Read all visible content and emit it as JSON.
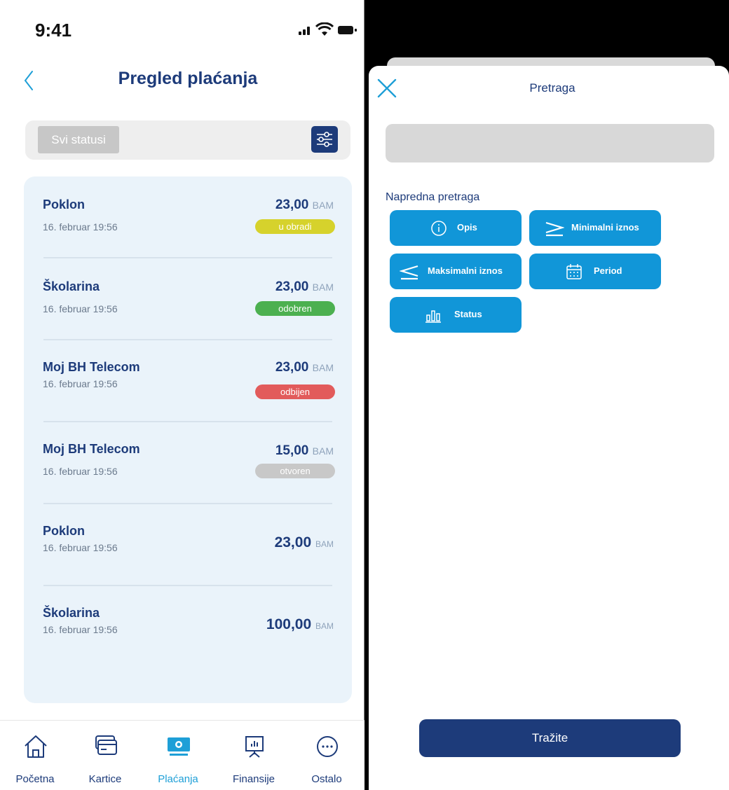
{
  "status_bar": {
    "time": "9:41"
  },
  "left_screen": {
    "title": "Pregled plaćanja",
    "filter": {
      "status_value": "Svi statusi"
    },
    "transactions": [
      {
        "name": "Poklon",
        "date": "16. februar 19:56",
        "amount": "23,00",
        "currency": "BAM",
        "status": "u obradi",
        "status_color": "#d6d22c"
      },
      {
        "name": "Školarina",
        "date": "16. februar 19:56",
        "amount": "23,00",
        "currency": "BAM",
        "status": "odobren",
        "status_color": "#4cb050"
      },
      {
        "name": "Moj BH Telecom",
        "date": "16. februar 19:56",
        "amount": "23,00",
        "currency": "BAM",
        "status": "odbijen",
        "status_color": "#e25b5b"
      },
      {
        "name": "Moj BH Telecom",
        "date": "16. februar 19:56",
        "amount": "15,00",
        "currency": "BAM",
        "status": "otvoren",
        "status_color": "#c8c8c8"
      },
      {
        "name": "Poklon",
        "date": "16. februar 19:56",
        "amount": "23,00",
        "currency": "BAM"
      },
      {
        "name": "Školarina",
        "date": "16. februar 19:56",
        "amount": "100,00",
        "currency": "BAM"
      }
    ],
    "bottom_nav": [
      {
        "label": "Početna",
        "icon": "home-icon"
      },
      {
        "label": "Kartice",
        "icon": "cards-icon"
      },
      {
        "label": "Plaćanja",
        "icon": "payments-icon",
        "active": true
      },
      {
        "label": "Finansije",
        "icon": "finance-icon"
      },
      {
        "label": "Ostalo",
        "icon": "more-icon"
      }
    ]
  },
  "right_screen": {
    "title": "Pretraga",
    "search": {
      "value": "",
      "placeholder": ""
    },
    "advanced_label": "Napredna pretraga",
    "chips": [
      {
        "label": "Opis",
        "icon": "info-icon"
      },
      {
        "label": "Minimalni iznos",
        "icon": "greater-equal-icon"
      },
      {
        "label": "Maksimalni iznos",
        "icon": "less-equal-icon"
      },
      {
        "label": "Period",
        "icon": "calendar-icon"
      },
      {
        "label": "Status",
        "icon": "bar-chart-icon"
      }
    ],
    "search_button": "Tražite"
  },
  "colors": {
    "primary": "#1d3b7a",
    "accent": "#1196d8",
    "active_nav": "#1e9fd7"
  }
}
